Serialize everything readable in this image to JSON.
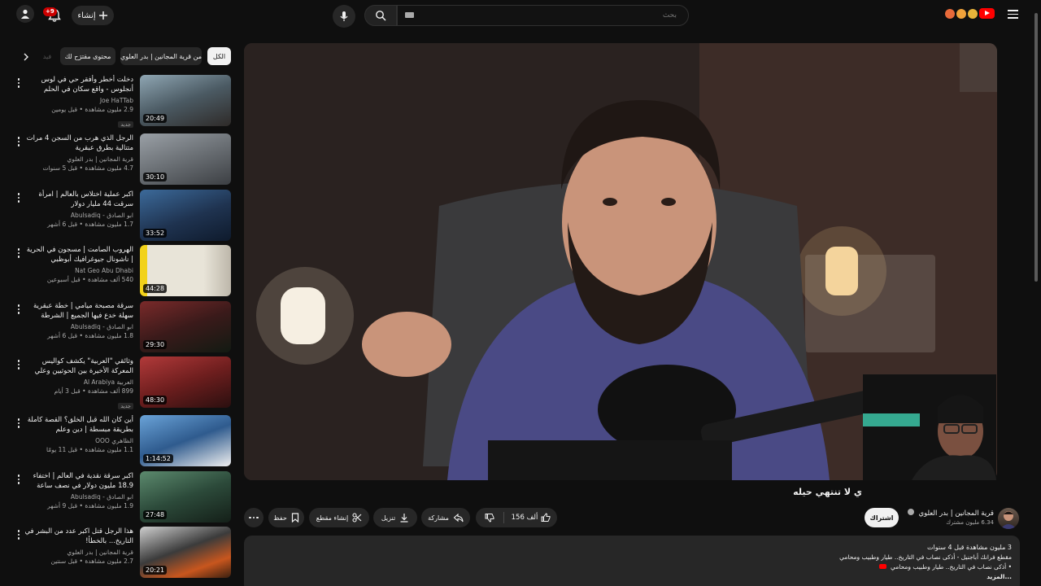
{
  "topbar": {
    "create_label": "إنشاء",
    "notif_count": "+9",
    "search_placeholder": "بحث"
  },
  "chips": [
    "الكل",
    "من قرية المجانين | بدر العلوي",
    "محتوى مقترَح لك",
    "فيد"
  ],
  "recs": [
    {
      "title": "دخلت أخطر وأفقر حي في لوس أنجلوس - واقع سكان في الحلم الأمريكي us",
      "channel": "Joe HaTTab",
      "views": "2.9 مليون مشاهدة • قبل يومين",
      "badge": "جديد",
      "duration": "20:49",
      "thumb_color": "#4b5a63"
    },
    {
      "title": "الرجل الذي هرب من السجن 4 مرات متتالية بطرق عبقرية",
      "channel": "قرية المجانين | بدر العلوي",
      "views": "4.7 مليون مشاهدة • قبل 5 سنوات",
      "badge": "",
      "duration": "30:10",
      "thumb_color": "#6a6f74"
    },
    {
      "title": "اكبر عملية اختلاس بالعالم | امرأة سرقت 44 مليار دولار",
      "channel": "ابو الصادق - Abulsadiq",
      "views": "1.7 مليون مشاهدة • قبل 6 أشهر",
      "badge": "",
      "duration": "33:52",
      "thumb_color": "#1f3350"
    },
    {
      "title": "الهروب الصامت | مسجون في الحرية | ناشونال جيوغرافيك أبوظبي",
      "channel": "Nat Geo Abu Dhabi",
      "views": "540 ألف مشاهدة • قبل أسبوعين",
      "badge": "",
      "duration": "44:28",
      "thumb_color": "#d9d4c8"
    },
    {
      "title": "سرقة مصبحة ميامي | خطة عبقرية سهلة خدع فيها الجميع | الشرطة والمسابقة",
      "channel": "ابو الصادق - Abulsadiq",
      "views": "1.8 مليون مشاهدة • قبل 6 أشهر",
      "badge": "",
      "duration": "29:30",
      "thumb_color": "#3a1a1a"
    },
    {
      "title": "وثائقي \"العربية\" يكشف كواليس المعركة الأخيرة بين الحوثيين وعلي عبد الله صالح",
      "channel": "العربية Al Arabiya",
      "views": "899 ألف مشاهدة • قبل 3 أيام",
      "badge": "جديد",
      "duration": "48:30",
      "thumb_color": "#6e1e1e"
    },
    {
      "title": "أين كان الله قبل الخلق؟ القصة كاملة بطريقة مبسطة | دين وعلم",
      "channel": "الظاهري OOO",
      "views": "1.1 مليون مشاهدة • قبل 11 يومًا",
      "badge": "",
      "duration": "1:14:52",
      "thumb_color": "#2f5b8e"
    },
    {
      "title": "اكبر سرقة نقدية في العالم | اختفاء 18.9 مليون دولار في نصف ساعة",
      "channel": "ابو الصادق - Abulsadiq",
      "views": "1.9 مليون مشاهدة • قبل 9 أشهر",
      "badge": "",
      "duration": "27:48",
      "thumb_color": "#2c4a3a"
    },
    {
      "title": "هذا الرجل قتل اكبر عدد من البشر في التاريخ... بالخطأ!",
      "channel": "قرية المجانين | بدر العلوي",
      "views": "2.7 مليون مشاهدة • قبل سنتين",
      "badge": "",
      "duration": "20:21",
      "thumb_color": "#3b3b3b"
    }
  ],
  "video": {
    "title": "ي لا تنتهي حيله",
    "likes": "156 ألف",
    "dislike_label": "",
    "share_label": "مشاركة",
    "download_label": "تنزيل",
    "clip_label": "إنشاء مقطع",
    "save_label": "حفظ"
  },
  "channel": {
    "name": "قرية المجانين | بدر العلوي",
    "subs": "6.34 مليون مشترك",
    "subscribe_label": "اشتراك"
  },
  "description": {
    "stats": "3 مليون مشاهدة  قبل 4 سنوات",
    "line1": "مقطع فرانك أباجنيل - أذكى نصاب في التاريخ.. طيار وطبيب ومحامي",
    "line2": "• أذكى نصاب في التاريخ.. طيار وطبيب ومحامي",
    "more": "...المزيد"
  },
  "colors": {
    "background": "#0f0f0f",
    "surface": "#272727",
    "brand_red": "#ff0000",
    "text": "#f1f1f1",
    "muted": "#aaaaaa"
  }
}
